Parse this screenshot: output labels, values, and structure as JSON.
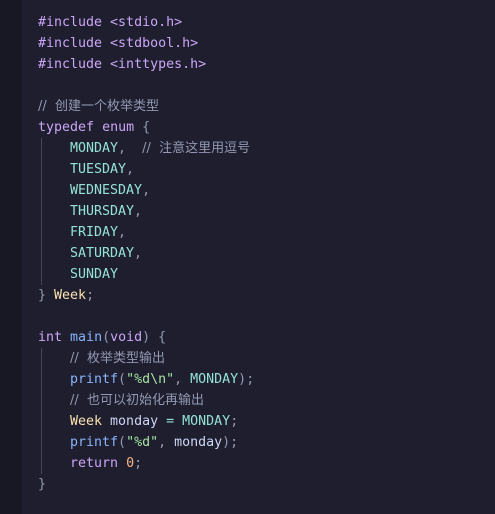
{
  "code": {
    "includes": [
      "#include <stdio.h>",
      "#include <stdbool.h>",
      "#include <inttypes.h>"
    ],
    "comment_enum": "//  创建一个枚举类型",
    "kw_typedef": "typedef",
    "kw_enum": "enum",
    "brace_open": "{",
    "enum_values": [
      "MONDAY",
      "TUESDAY",
      "WEDNESDAY",
      "THURSDAY",
      "FRIDAY",
      "SATURDAY",
      "SUNDAY"
    ],
    "comma": ",",
    "comment_comma": "//  注意这里用逗号",
    "brace_close": "}",
    "type_week": "Week",
    "semicolon": ";",
    "kw_int": "int",
    "fn_main": "main",
    "paren_open": "(",
    "kw_void": "void",
    "paren_close": ")",
    "comment_output": "//  枚举类型输出",
    "fn_printf": "printf",
    "str_d_n": "\"%d\\n\"",
    "arg_monday": "MONDAY",
    "comment_init": "//  也可以初始化再输出",
    "var_monday": "monday",
    "op_assign": "=",
    "str_d": "\"%d\"",
    "kw_return": "return",
    "num_zero": "0",
    "separator": ", "
  },
  "colors": {
    "background": "#1e1e2e",
    "gutter": "#181825",
    "keyword": "#cba6f7",
    "type": "#f9e2af",
    "function": "#89b4fa",
    "string": "#a6e3a1",
    "number": "#fab387",
    "enum_constant": "#94e2d5",
    "comment": "#9399b2",
    "text": "#cdd6f4"
  }
}
